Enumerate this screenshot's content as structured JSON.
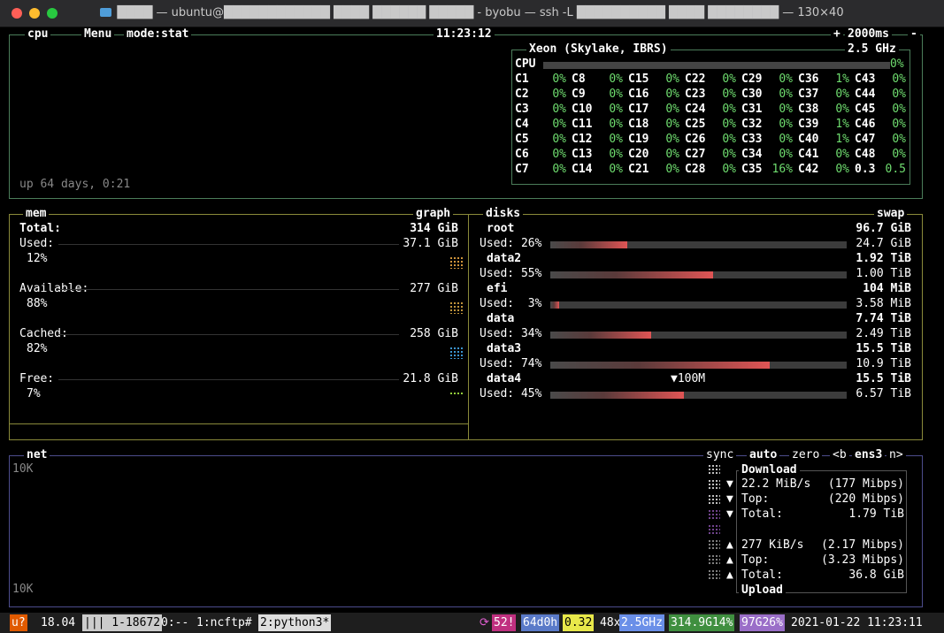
{
  "window": {
    "title": "████ — ubuntu@████████████ ████ ██████ █████ - byobu — ssh -L ██████████ ████ ████████ — 130×40"
  },
  "cpu": {
    "label": "cpu",
    "menu": "Menu",
    "mode": "mode:stat",
    "clock": "11:23:12",
    "interval": "2000ms",
    "plus": "+",
    "minus": "-",
    "model": "Xeon (Skylake, IBRS)",
    "freq": "2.5 GHz",
    "total_label": "CPU",
    "total_pct": "0%",
    "uptime": "up 64 days, 0:21",
    "columns": [
      [
        [
          "C1",
          "0%"
        ],
        [
          "C2",
          "0%"
        ],
        [
          "C3",
          "0%"
        ],
        [
          "C4",
          "0%"
        ],
        [
          "C5",
          "0%"
        ],
        [
          "C6",
          "0%"
        ],
        [
          "C7",
          "0%"
        ]
      ],
      [
        [
          "C8",
          "0%"
        ],
        [
          "C9",
          "0%"
        ],
        [
          "C10",
          "0%"
        ],
        [
          "C11",
          "0%"
        ],
        [
          "C12",
          "0%"
        ],
        [
          "C13",
          "0%"
        ],
        [
          "C14",
          "0%"
        ]
      ],
      [
        [
          "C15",
          "0%"
        ],
        [
          "C16",
          "0%"
        ],
        [
          "C17",
          "0%"
        ],
        [
          "C18",
          "0%"
        ],
        [
          "C19",
          "0%"
        ],
        [
          "C20",
          "0%"
        ],
        [
          "C21",
          "0%"
        ]
      ],
      [
        [
          "C22",
          "0%"
        ],
        [
          "C23",
          "0%"
        ],
        [
          "C24",
          "0%"
        ],
        [
          "C25",
          "0%"
        ],
        [
          "C26",
          "0%"
        ],
        [
          "C27",
          "0%"
        ],
        [
          "C28",
          "0%"
        ]
      ],
      [
        [
          "C29",
          "0%"
        ],
        [
          "C30",
          "0%"
        ],
        [
          "C31",
          "0%"
        ],
        [
          "C32",
          "0%"
        ],
        [
          "C33",
          "0%"
        ],
        [
          "C34",
          "0%"
        ],
        [
          "C35",
          "16%"
        ]
      ],
      [
        [
          "C36",
          "1%"
        ],
        [
          "C37",
          "0%"
        ],
        [
          "C38",
          "0%"
        ],
        [
          "C39",
          "1%"
        ],
        [
          "C40",
          "1%"
        ],
        [
          "C41",
          "0%"
        ],
        [
          "C42",
          "0%"
        ]
      ],
      [
        [
          "C43",
          "0%"
        ],
        [
          "C44",
          "0%"
        ],
        [
          "C45",
          "0%"
        ],
        [
          "C46",
          "0%"
        ],
        [
          "C47",
          "0%"
        ],
        [
          "C48",
          "0%"
        ],
        [
          "0.3",
          "0.5"
        ]
      ]
    ]
  },
  "mem": {
    "label": "mem",
    "graph_label": "graph",
    "total_label": "Total:",
    "total_value": "314 GiB",
    "rows": [
      {
        "label": "Used:",
        "value": "37.1 GiB",
        "pct": "12%"
      },
      {
        "label": "Available:",
        "value": "277 GiB",
        "pct": "88%"
      },
      {
        "label": "Cached:",
        "value": "258 GiB",
        "pct": "82%"
      },
      {
        "label": "Free:",
        "value": "21.8 GiB",
        "pct": "7%"
      }
    ]
  },
  "disks": {
    "label": "disks",
    "swap_label": "swap",
    "io_marker": "▼100M",
    "items": [
      {
        "name": "root",
        "total": "96.7 GiB",
        "used": "Used: 26%",
        "free": "24.7 GiB",
        "fill": 0.26
      },
      {
        "name": "data2",
        "total": "1.92 TiB",
        "used": "Used: 55%",
        "free": "1.00 TiB",
        "fill": 0.55
      },
      {
        "name": "efi",
        "total": "104 MiB",
        "used": "Used:  3%",
        "free": "3.58 MiB",
        "fill": 0.03
      },
      {
        "name": "data",
        "total": "7.74 TiB",
        "used": "Used: 34%",
        "free": "2.49 TiB",
        "fill": 0.34
      },
      {
        "name": "data3",
        "total": "15.5 TiB",
        "used": "Used: 74%",
        "free": "10.9 TiB",
        "fill": 0.74
      },
      {
        "name": "data4",
        "total": "15.5 TiB",
        "used": "Used: 45%",
        "free": "6.57 TiB",
        "fill": 0.45
      }
    ]
  },
  "net": {
    "label": "net",
    "sync": "sync",
    "auto": "auto",
    "zero": "zero",
    "prev": "<b",
    "iface": "ens3",
    "next": "n>",
    "scale_top": "10K",
    "scale_bottom": "10K",
    "download_title": "Download",
    "upload_title": "Upload",
    "download": [
      {
        "arrow": "▼",
        "label": "22.2 MiB/s",
        "value": "(177 Mibps)"
      },
      {
        "arrow": "▼",
        "label": "Top:",
        "value": "(220 Mibps)"
      },
      {
        "arrow": "▼",
        "label": "Total:",
        "value": "1.79 TiB"
      }
    ],
    "upload": [
      {
        "arrow": "▲",
        "label": "277 KiB/s",
        "value": "(2.17 Mibps)"
      },
      {
        "arrow": "▲",
        "label": "Top:",
        "value": "(3.23 Mibps)"
      },
      {
        "arrow": "▲",
        "label": "Total:",
        "value": "36.8 GiB"
      }
    ]
  },
  "statusbar": {
    "logo": "u?",
    "release": "18.04",
    "sessions": "||| 1-18672",
    "win0": "0:-- ",
    "win1": "1:ncftp#",
    "win2": "2:python3*",
    "updates": "52!",
    "uptime": "64d0h",
    "load": "0.32",
    "cpu": "48x",
    "freq": "2.5GHz",
    "mem": "314.9G14%",
    "disk": "97G26%",
    "datetime": "2021-01-22 11:23:11"
  },
  "colors": {
    "cpu_border": "#4b7d5a",
    "mem_border": "#8a8a3a",
    "net_border": "#4c4c8c",
    "disk_bar": "#e05555"
  }
}
